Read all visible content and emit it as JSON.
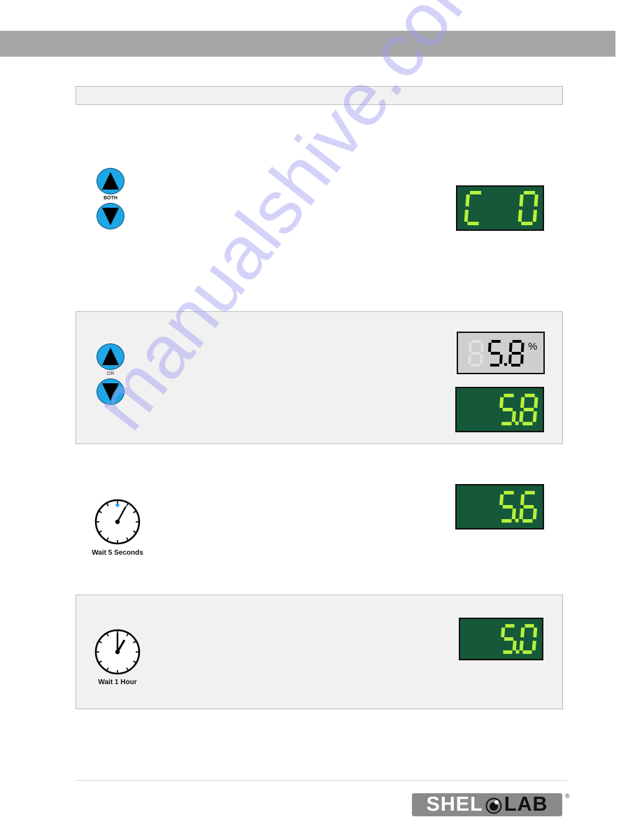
{
  "page": {
    "header_band": "",
    "title_bar": ""
  },
  "step1": {
    "buttons": {
      "up_icon": "triangle-up",
      "down_icon": "triangle-down",
      "connector_label": "BOTH"
    },
    "display": {
      "type": "green-led",
      "left_char": "C",
      "right_char": "0"
    }
  },
  "step2": {
    "buttons": {
      "up_icon": "triangle-up",
      "down_icon": "triangle-down",
      "connector_label": "OR"
    },
    "display_lcd": {
      "type": "gray-lcd",
      "ghost_digit": "8",
      "value": "5.8",
      "unit": "%"
    },
    "display_led": {
      "type": "green-led",
      "value": "5.8"
    }
  },
  "step3": {
    "timer": {
      "icon": "stopwatch",
      "caption": "Wait 5 Seconds"
    },
    "display": {
      "type": "green-led",
      "value": "5.6"
    }
  },
  "step4": {
    "timer": {
      "icon": "clock",
      "caption": "Wait 1 Hour"
    },
    "display": {
      "type": "green-led",
      "value": "5.0"
    }
  },
  "footer": {
    "logo": {
      "left": "SHEL",
      "right": "LAB",
      "registered": "®"
    }
  },
  "watermark": "manualshive.com",
  "colors": {
    "header_band": "#a6a6a6",
    "panel_bg": "#f1f1f1",
    "button_blue": "#1ea6e6",
    "led_bg": "#16583a",
    "led_segment": "#b6f23c",
    "lcd_bg": "#cfcfcf"
  }
}
